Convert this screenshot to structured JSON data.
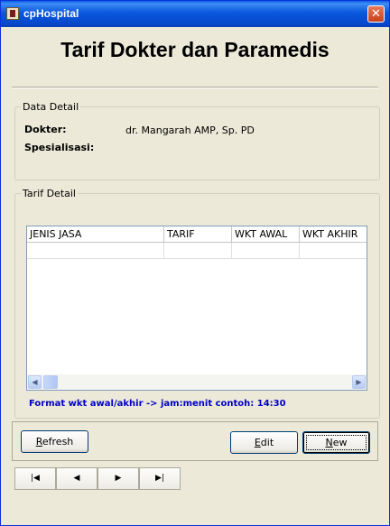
{
  "window": {
    "title": "cpHospital",
    "close_glyph": "✕"
  },
  "heading": "Tarif Dokter dan Paramedis",
  "data_detail": {
    "legend": "Data Detail",
    "dokter_label": "Dokter:",
    "dokter_value": "dr. Mangarah AMP, Sp. PD",
    "spesialisasi_label": "Spesialisasi:",
    "spesialisasi_value": ""
  },
  "tarif_detail": {
    "legend": "Tarif Detail",
    "columns": [
      "JENIS JASA",
      "TARIF",
      "WKT AWAL",
      "WKT AKHIR"
    ],
    "rows": [],
    "hint": "Format wkt awal/akhir -> jam:menit contoh: 14:30"
  },
  "scrollbar": {
    "left_glyph": "◀",
    "right_glyph": "▶"
  },
  "buttons": {
    "refresh": {
      "accel": "R",
      "rest": "efresh"
    },
    "edit": {
      "accel": "E",
      "rest": "dit"
    },
    "new": {
      "accel": "N",
      "rest": "ew"
    }
  },
  "navigation": {
    "first": "|◀",
    "prev": "◀",
    "next": "▶",
    "last": "▶|"
  },
  "colors": {
    "title_bar": "#0a58de",
    "hint_text": "#0000c8",
    "window_bg": "#ece9d8"
  }
}
